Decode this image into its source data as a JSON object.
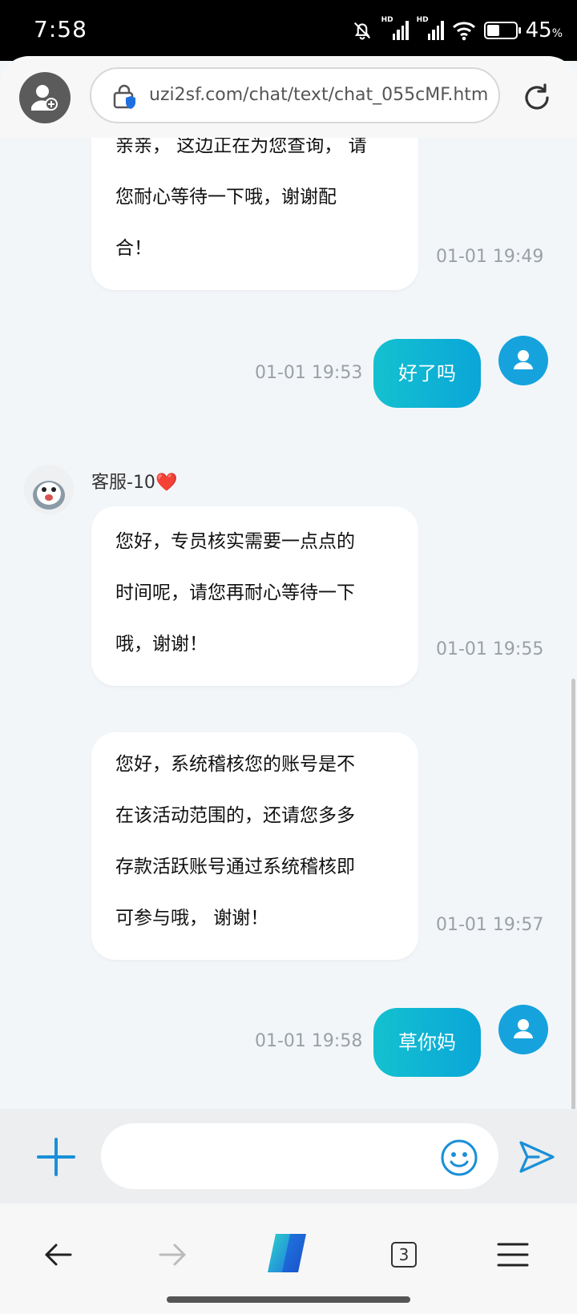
{
  "status_bar": {
    "time": "7:58",
    "battery_percent": "45",
    "battery_unit": "%",
    "battery_level": 0.45,
    "signal_labels": [
      "HD",
      "HD"
    ],
    "icons": [
      "bell-off-icon",
      "signal-icon",
      "signal-icon",
      "wifi-icon",
      "battery-icon"
    ]
  },
  "browser": {
    "url": "uzi2sf.com/chat/text/chat_055cMF.htm",
    "icons": [
      "profile-add-icon",
      "shield-lock-icon",
      "reload-icon"
    ]
  },
  "chat": {
    "messages": [
      {
        "side": "left",
        "lines": [
          "亲亲， 这边正在为您查询， 请",
          "您耐心等待一下哦，谢谢配",
          "合！"
        ],
        "time": "01-01 19:49"
      },
      {
        "side": "right",
        "text": "好了吗",
        "time": "01-01 19:53"
      },
      {
        "side": "left",
        "agent": "客服-10",
        "lines": [
          "您好，专员核实需要一点点的",
          "时间呢，请您再耐心等待一下",
          "哦，谢谢！"
        ],
        "time": "01-01 19:55"
      },
      {
        "side": "left",
        "lines": [
          "您好，系统稽核您的账号是不",
          "在该活动范围的，还请您多多",
          "存款活跃账号通过系统稽核即",
          "可参与哦， 谢谢！"
        ],
        "time": "01-01 19:57"
      },
      {
        "side": "right",
        "text": "草你妈",
        "time": "01-01 19:58"
      }
    ],
    "agent_name": "客服-10",
    "agent_badge": "❤️"
  },
  "input": {
    "placeholder": "",
    "value": "",
    "icons": [
      "plus-icon",
      "emoji-icon",
      "send-icon"
    ]
  },
  "bottom_nav": {
    "tab_count": "3",
    "icons": [
      "back-arrow-icon",
      "forward-arrow-icon",
      "copilot-logo-icon",
      "tabs-icon",
      "menu-icon"
    ]
  },
  "colors": {
    "accent": "#16a3dd",
    "bubble_gradient_start": "#14c1cf",
    "bubble_gradient_end": "#0aa6d8",
    "chat_bg": "#f3f6f9"
  }
}
